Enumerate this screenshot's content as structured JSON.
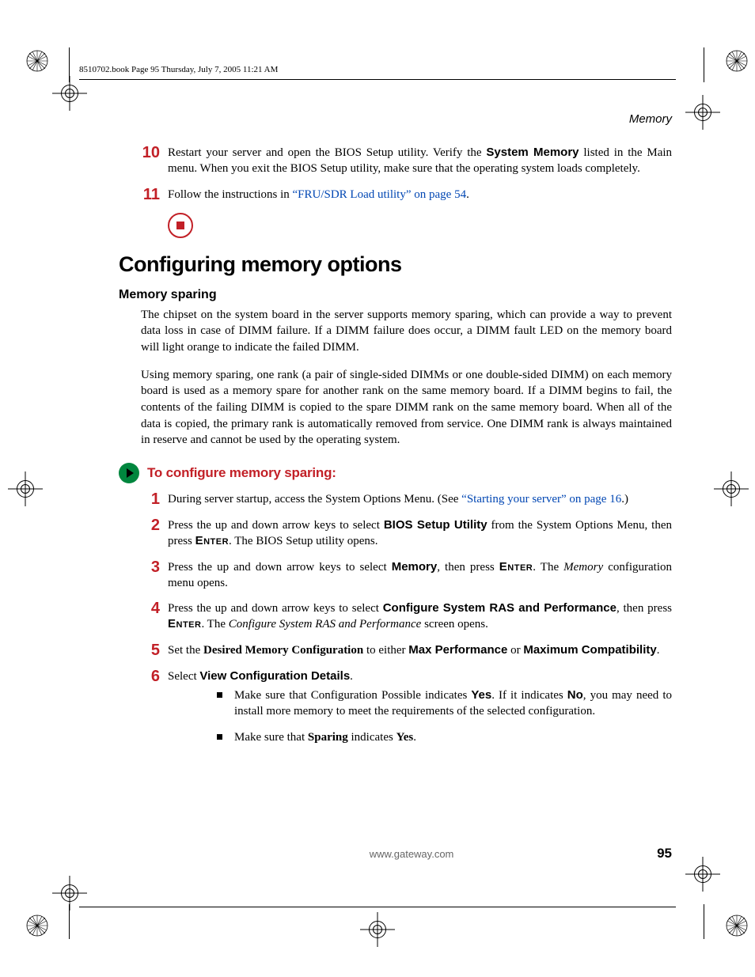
{
  "stamp": "8510702.book  Page 95  Thursday, July 7, 2005  11:21 AM",
  "running_head": "Memory",
  "prev_steps": [
    {
      "num": "10",
      "t1": "Restart your server and open the BIOS Setup utility. Verify the ",
      "b1": "System Memory",
      "t2": " listed in the Main menu. When you exit the BIOS Setup utility, make sure that the operating system loads completely."
    },
    {
      "num": "11",
      "t1": "Follow the instructions in ",
      "link": "“FRU/SDR Load utility” on page 54",
      "t2": "."
    }
  ],
  "section_title": "Configuring memory options",
  "subhead": "Memory sparing",
  "para1": "The chipset on the system board in the server supports memory sparing, which can provide a way to prevent data loss in case of DIMM failure. If a DIMM failure does occur, a DIMM fault LED on the memory board will light orange to indicate the failed DIMM.",
  "para2": "Using memory sparing, one rank (a pair of single-sided DIMMs or one double-sided DIMM) on each memory board is used as a memory spare for another rank on the same memory board. If a DIMM begins to fail, the contents of the failing DIMM is copied to the spare DIMM rank on the same memory board. When all of the data is copied, the primary rank is automatically removed from service. One DIMM rank is always maintained in reserve and cannot be used by the operating system.",
  "proc_title": "To configure memory sparing:",
  "steps": [
    {
      "num": "1",
      "t1": "During server startup, access the System Options Menu. (See ",
      "link": "“Starting your server” on page 16",
      "t2": ".)"
    },
    {
      "num": "2",
      "t1": "Press the up and down arrow keys to select ",
      "b1": "BIOS Setup Utility",
      "t2": " from the System Options Menu, then press ",
      "sc1": "Enter",
      "t3": ". The BIOS Setup utility opens."
    },
    {
      "num": "3",
      "t1": "Press the up and down arrow keys to select ",
      "b1": "Memory",
      "t2": ", then press ",
      "sc1": "Enter",
      "t3": ". The ",
      "i1": "Memory",
      "t4": " configuration menu opens."
    },
    {
      "num": "4",
      "t1": "Press the up and down arrow keys to select ",
      "b1": "Configure System RAS and Performance",
      "t2": ", then press ",
      "sc1": "Enter",
      "t3": ". The ",
      "i1": "Configure System RAS and Performance",
      "t4": " screen opens."
    },
    {
      "num": "5",
      "t1": "Set the ",
      "b0": "Desired Memory Configuration",
      "t1b": " to either ",
      "b1": "Max Performance",
      "t2": " or ",
      "b2": "Maximum Compatibility",
      "t3": "."
    },
    {
      "num": "6",
      "t1": "Select ",
      "b1": "View Configuration Details",
      "t2": ".",
      "bullets": [
        {
          "t1": "Make sure that Configuration Possible indicates ",
          "b1": "Yes",
          "t2": ". If it indicates ",
          "b2": "No",
          "t3": ", you may need to install more memory to meet the requirements of the selected configuration."
        },
        {
          "t1": "Make sure that ",
          "b1": "Sparing",
          "t2": " indicates ",
          "b2": "Yes",
          "t3": "."
        }
      ]
    }
  ],
  "footer": {
    "url": "www.gateway.com",
    "page": "95"
  }
}
